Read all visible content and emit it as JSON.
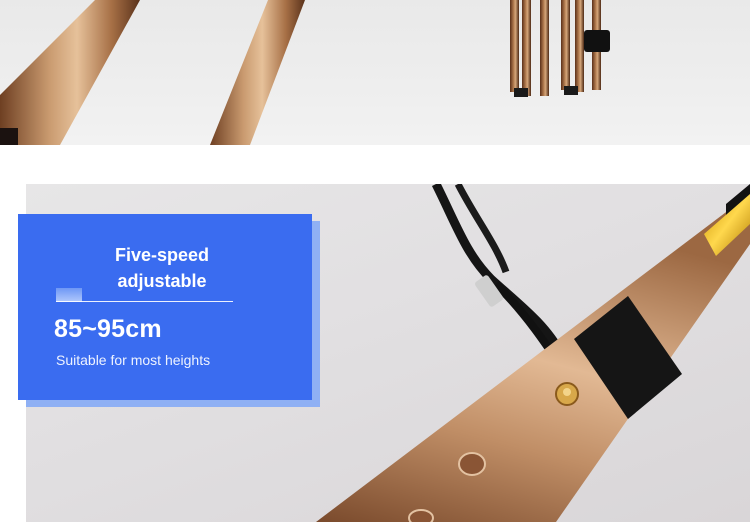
{
  "card": {
    "title_line1": "Five-speed",
    "title_line2": "adjustable",
    "range": "85~95cm",
    "subtitle": "Suitable for most heights"
  },
  "colors": {
    "card_blue": "#3a6cf0",
    "card_shadow": "#8fb0f4",
    "cane_bronze": "#b98a63"
  }
}
